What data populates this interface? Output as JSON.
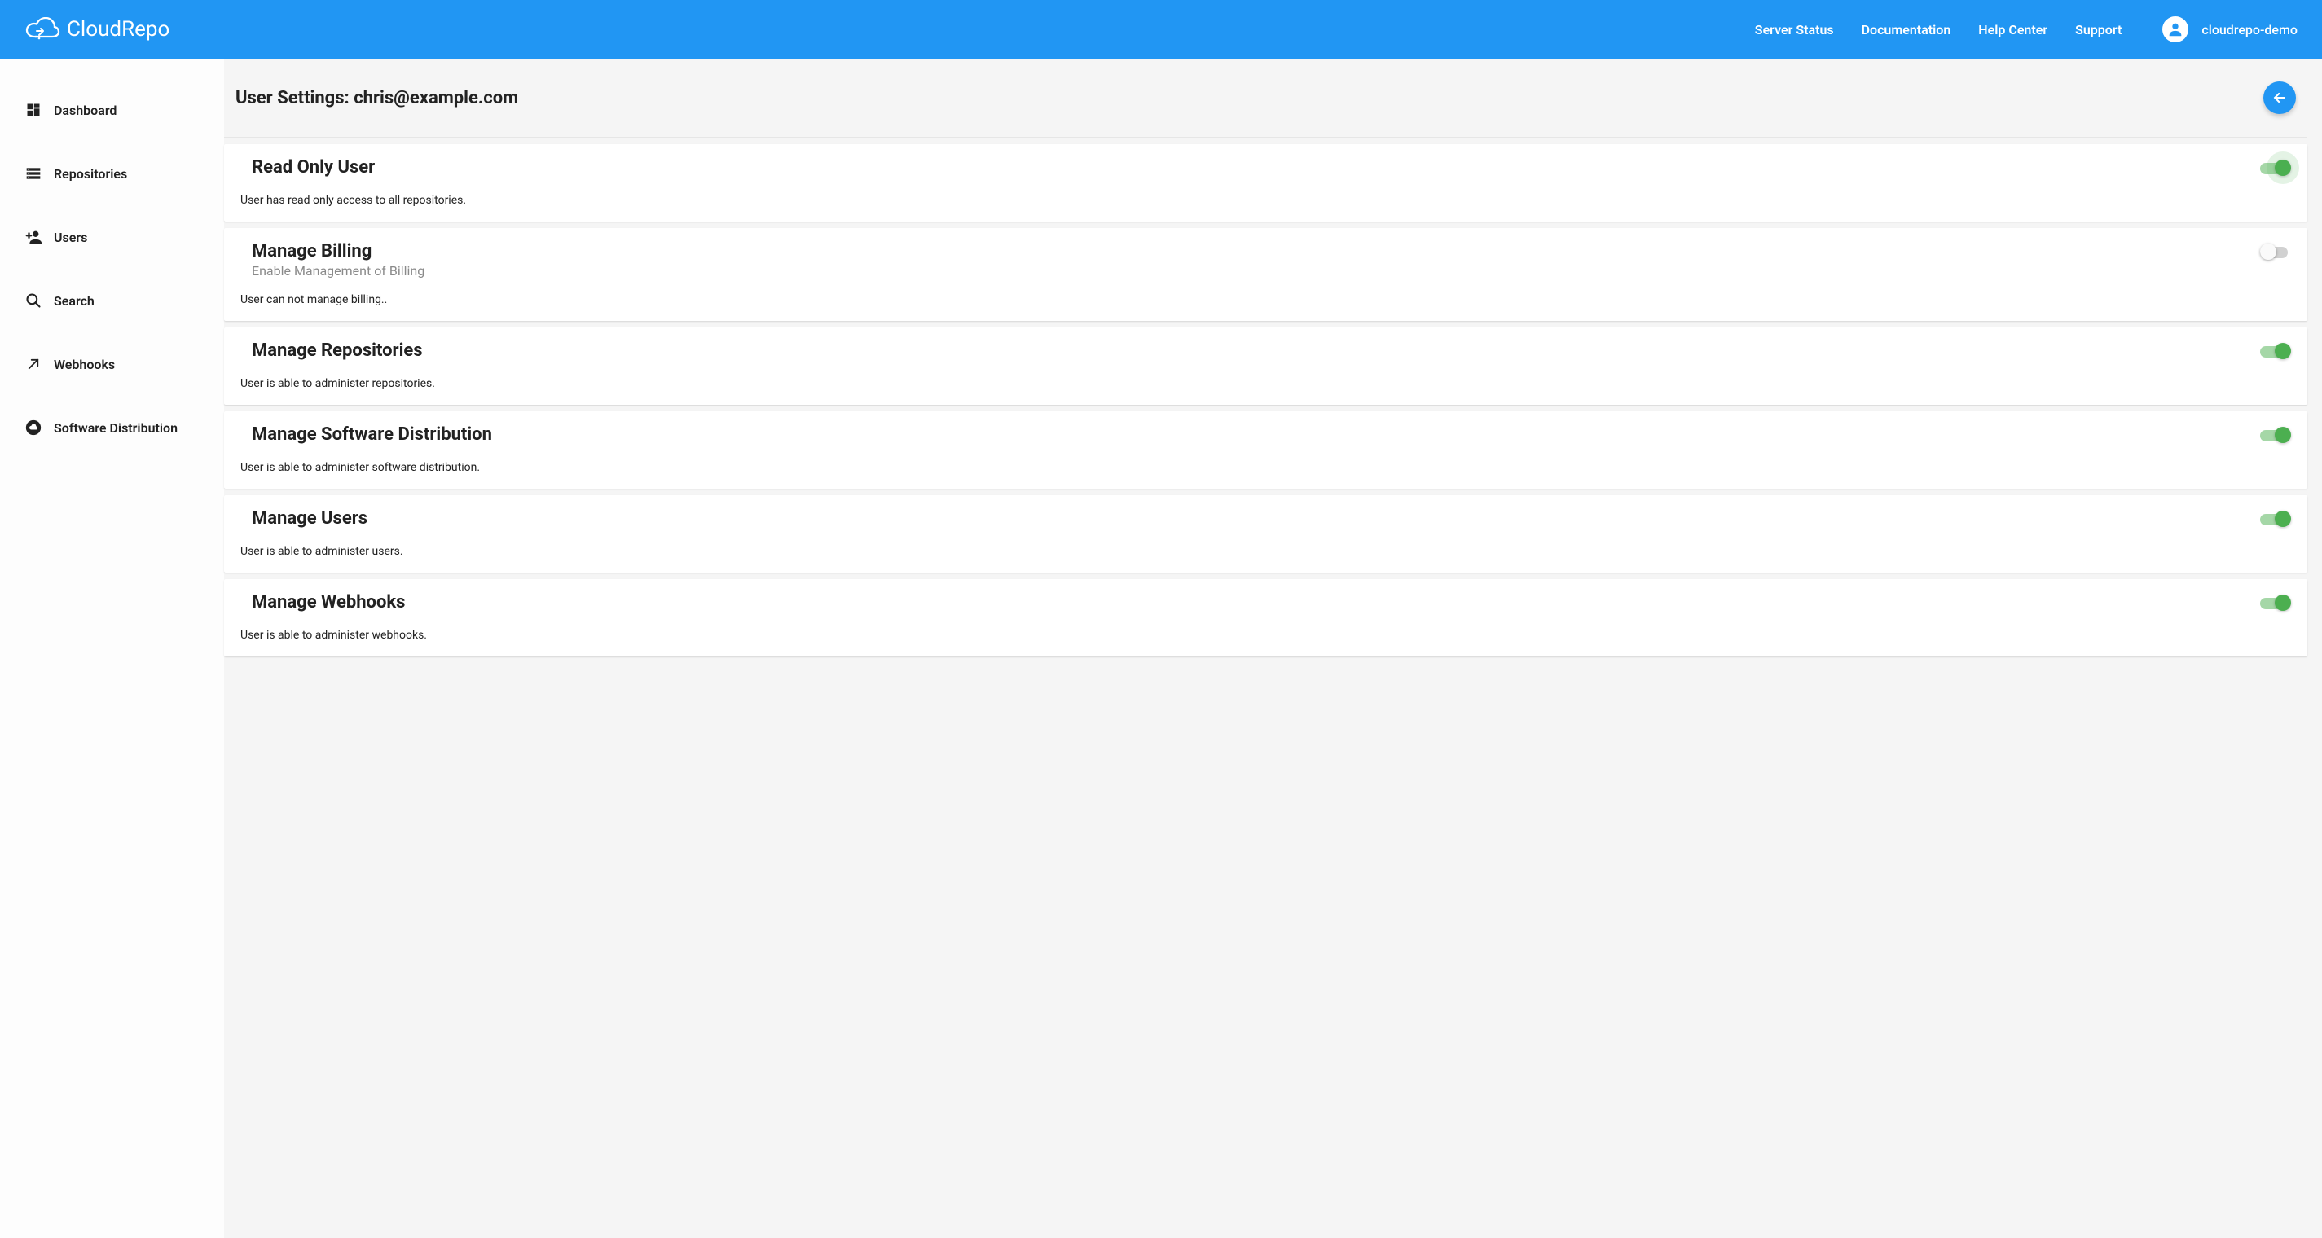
{
  "brand": "CloudRepo",
  "nav": {
    "server_status": "Server Status",
    "documentation": "Documentation",
    "help_center": "Help Center",
    "support": "Support"
  },
  "user": {
    "name": "cloudrepo-demo"
  },
  "sidebar": {
    "items": [
      {
        "label": "Dashboard"
      },
      {
        "label": "Repositories"
      },
      {
        "label": "Users"
      },
      {
        "label": "Search"
      },
      {
        "label": "Webhooks"
      },
      {
        "label": "Software Distribution"
      }
    ]
  },
  "page": {
    "title": "User Settings: chris@example.com"
  },
  "settings": [
    {
      "title": "Read Only User",
      "subtitle": "",
      "desc": "User has read only access to all repositories.",
      "on": true,
      "halo": true
    },
    {
      "title": "Manage Billing",
      "subtitle": "Enable Management of Billing",
      "desc": "User can not manage billing..",
      "on": false,
      "halo": false
    },
    {
      "title": "Manage Repositories",
      "subtitle": "",
      "desc": "User is able to administer repositories.",
      "on": true,
      "halo": false
    },
    {
      "title": "Manage Software Distribution",
      "subtitle": "",
      "desc": "User is able to administer software distribution.",
      "on": true,
      "halo": false
    },
    {
      "title": "Manage Users",
      "subtitle": "",
      "desc": "User is able to administer users.",
      "on": true,
      "halo": false
    },
    {
      "title": "Manage Webhooks",
      "subtitle": "",
      "desc": "User is able to administer webhooks.",
      "on": true,
      "halo": false
    }
  ]
}
